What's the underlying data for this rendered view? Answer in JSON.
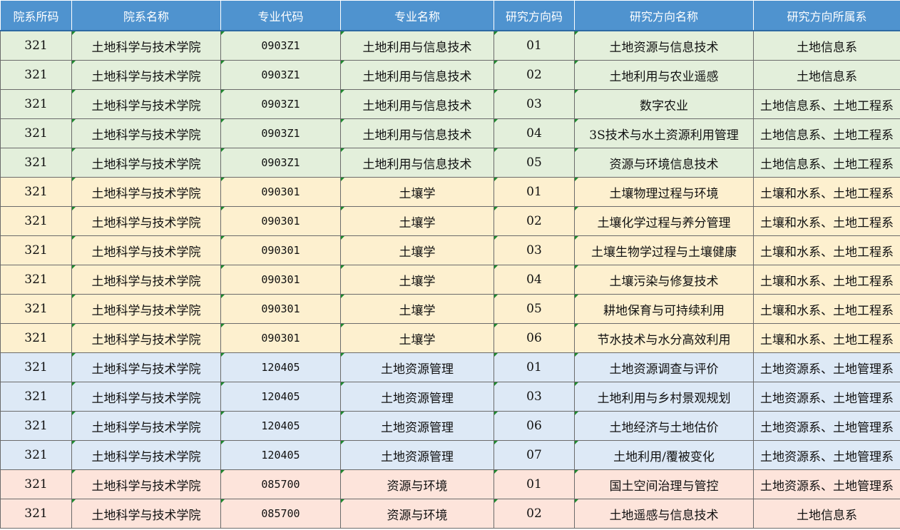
{
  "table": {
    "headers": [
      "院系所码",
      "院系名称",
      "专业代码",
      "专业名称",
      "研究方向码",
      "研究方向名称",
      "研究方向所属系"
    ],
    "rows": [
      {
        "group": "green",
        "cells": [
          "321",
          "土地科学与技术学院",
          "0903Z1",
          "土地利用与信息技术",
          "01",
          "土地资源与信息技术",
          "土地信息系"
        ]
      },
      {
        "group": "green",
        "cells": [
          "321",
          "土地科学与技术学院",
          "0903Z1",
          "土地利用与信息技术",
          "02",
          "土地利用与农业遥感",
          "土地信息系"
        ]
      },
      {
        "group": "green",
        "cells": [
          "321",
          "土地科学与技术学院",
          "0903Z1",
          "土地利用与信息技术",
          "03",
          "数字农业",
          "土地信息系、土地工程系"
        ]
      },
      {
        "group": "green",
        "cells": [
          "321",
          "土地科学与技术学院",
          "0903Z1",
          "土地利用与信息技术",
          "04",
          "3S技术与水土资源利用管理",
          "土地信息系、土地工程系"
        ]
      },
      {
        "group": "green",
        "cells": [
          "321",
          "土地科学与技术学院",
          "0903Z1",
          "土地利用与信息技术",
          "05",
          "资源与环境信息技术",
          "土地信息系、土地工程系"
        ]
      },
      {
        "group": "yellow",
        "cells": [
          "321",
          "土地科学与技术学院",
          "090301",
          "土壤学",
          "01",
          "土壤物理过程与环境",
          "土壤和水系、土地工程系"
        ]
      },
      {
        "group": "yellow",
        "cells": [
          "321",
          "土地科学与技术学院",
          "090301",
          "土壤学",
          "02",
          "土壤化学过程与养分管理",
          "土壤和水系、土地工程系"
        ]
      },
      {
        "group": "yellow",
        "cells": [
          "321",
          "土地科学与技术学院",
          "090301",
          "土壤学",
          "03",
          "土壤生物学过程与土壤健康",
          "土壤和水系、土地工程系"
        ]
      },
      {
        "group": "yellow",
        "cells": [
          "321",
          "土地科学与技术学院",
          "090301",
          "土壤学",
          "04",
          "土壤污染与修复技术",
          "土壤和水系、土地工程系"
        ]
      },
      {
        "group": "yellow",
        "cells": [
          "321",
          "土地科学与技术学院",
          "090301",
          "土壤学",
          "05",
          "耕地保育与可持续利用",
          "土壤和水系、土地工程系"
        ]
      },
      {
        "group": "yellow",
        "cells": [
          "321",
          "土地科学与技术学院",
          "090301",
          "土壤学",
          "06",
          "节水技术与水分高效利用",
          "土壤和水系、土地工程系"
        ]
      },
      {
        "group": "blue",
        "cells": [
          "321",
          "土地科学与技术学院",
          "120405",
          "土地资源管理",
          "01",
          "土地资源调查与评价",
          "土地资源系、土地管理系"
        ]
      },
      {
        "group": "blue",
        "cells": [
          "321",
          "土地科学与技术学院",
          "120405",
          "土地资源管理",
          "03",
          "土地利用与乡村景观规划",
          "土地资源系、土地管理系"
        ]
      },
      {
        "group": "blue",
        "cells": [
          "321",
          "土地科学与技术学院",
          "120405",
          "土地资源管理",
          "06",
          "土地经济与土地估价",
          "土地资源系、土地管理系"
        ]
      },
      {
        "group": "blue",
        "cells": [
          "321",
          "土地科学与技术学院",
          "120405",
          "土地资源管理",
          "07",
          "土地利用/覆被变化",
          "土地资源系、土地管理系"
        ]
      },
      {
        "group": "pink",
        "cells": [
          "321",
          "土地科学与技术学院",
          "085700",
          "资源与环境",
          "01",
          "国土空间治理与管控",
          "土地资源系、土地管理系"
        ]
      },
      {
        "group": "pink",
        "cells": [
          "321",
          "土地科学与技术学院",
          "085700",
          "资源与环境",
          "02",
          "土地遥感与信息技术",
          "土地信息系"
        ]
      }
    ]
  },
  "colors": {
    "header_bg": "#4f93cf",
    "group_green": "#e3efdb",
    "group_yellow": "#fdf0cf",
    "group_blue": "#dde9f6",
    "group_pink": "#fde4db",
    "cell_marker": "#1e8a2e"
  }
}
